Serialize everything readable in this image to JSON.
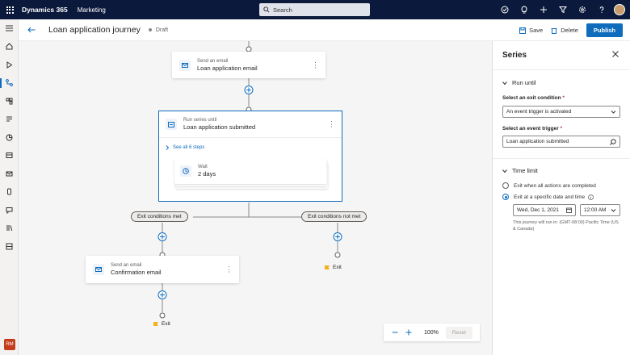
{
  "topbar": {
    "app_name": "Dynamics 365",
    "app_area": "Marketing",
    "search_placeholder": "Search"
  },
  "command_bar": {
    "journey_title": "Loan application journey",
    "status": "Draft",
    "save_label": "Save",
    "delete_label": "Delete",
    "publish_label": "Publish"
  },
  "canvas": {
    "email_card_1": {
      "type": "Send an email",
      "name": "Loan application email"
    },
    "series_card": {
      "type": "Run series until",
      "name": "Loan application submitted",
      "see_all": "See all 6 steps"
    },
    "wait_card": {
      "type": "Wait",
      "value": "2 days"
    },
    "exit_met": "Exit conditions met",
    "exit_not_met": "Exit conditions not met",
    "email_card_2": {
      "type": "Send an email",
      "name": "Confirmation email"
    },
    "exit_label": "Exit",
    "zoom": {
      "value": "100%",
      "reset": "Reset"
    }
  },
  "panel": {
    "title": "Series",
    "run_until": {
      "heading": "Run until",
      "exit_condition_label": "Select an exit condition",
      "exit_condition_value": "An event trigger is activated",
      "event_trigger_label": "Select an event trigger",
      "event_trigger_value": "Loan application submitted"
    },
    "time_limit": {
      "heading": "Time limit",
      "option_1": "Exit when all actions are completed",
      "option_2": "Exit at a specific date and time",
      "date": "Wed, Dec 1, 2021",
      "time": "12:00 AM",
      "note": "This journey will run in: (GMT-08:00) Pacific Time (US & Canada)"
    }
  },
  "user": {
    "initials": "RM"
  },
  "colors": {
    "topbar": "#0b1a3c",
    "accent": "#0f6cbd",
    "flag": "#f2b01e",
    "badge": "#c43e1c"
  }
}
